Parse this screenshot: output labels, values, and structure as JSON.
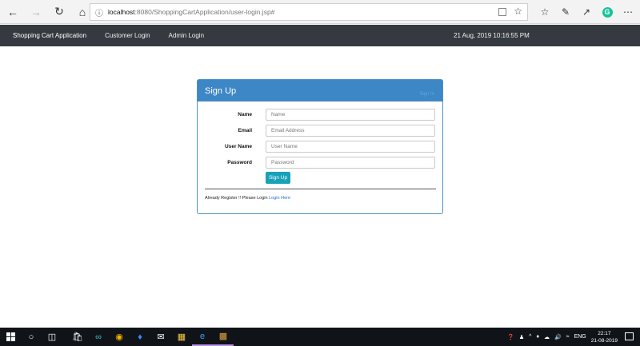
{
  "browser": {
    "url_host": "localhost",
    "url_path": ":8080/ShoppingCartApplication/user-login.jsp#"
  },
  "navbar": {
    "brand": "Shopping Cart Application",
    "links": [
      "Customer Login",
      "Admin Login"
    ],
    "datetime": "21 Aug, 2019 10:16:55 PM"
  },
  "signup": {
    "title": "Sign Up",
    "header_link": "Sign In",
    "fields": [
      {
        "label": "Name",
        "placeholder": "Name",
        "value": ""
      },
      {
        "label": "Email",
        "placeholder": "Email Address",
        "value": ""
      },
      {
        "label": "User Name",
        "placeholder": "User Name",
        "value": ""
      },
      {
        "label": "Password",
        "placeholder": "Password",
        "value": ""
      }
    ],
    "button": "Sign Up",
    "footer_text": "Already Register !! Please Login ",
    "footer_link": "Login Here"
  },
  "taskbar": {
    "language": "ENG",
    "time": "22:17",
    "date": "21-08-2019"
  },
  "colors": {
    "navbar_bg": "#343a40",
    "card_header": "#3e87c6",
    "button": "#17a2b8"
  }
}
